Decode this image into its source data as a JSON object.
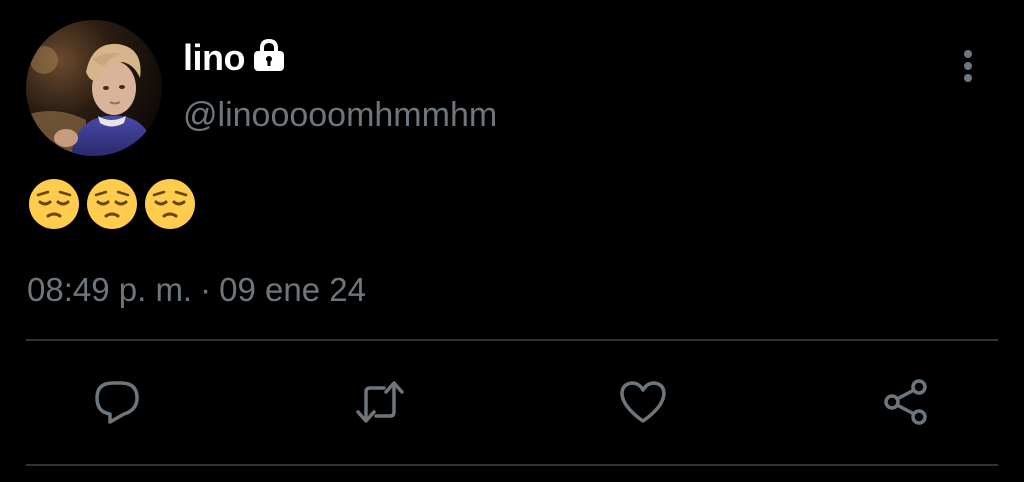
{
  "author": {
    "display_name": "lino",
    "handle": "@linooooomhmmhm",
    "protected_icon": "lock-icon",
    "avatar": "profile-photo"
  },
  "tweet": {
    "text": "😔😔😔",
    "emojis": [
      "pensive-face",
      "pensive-face",
      "pensive-face"
    ],
    "time": "08:49 p. m.",
    "separator": "·",
    "date": "09 ene 24"
  },
  "actions": {
    "reply_icon": "comment-icon",
    "retweet_icon": "retweet-icon",
    "like_icon": "heart-icon",
    "share_icon": "share-icon",
    "more_icon": "more-vertical-icon"
  },
  "colors": {
    "background": "#000000",
    "primary_text": "#ffffff",
    "secondary_text": "#6e767d",
    "divider": "#2f3336",
    "icon": "#6e767d"
  }
}
